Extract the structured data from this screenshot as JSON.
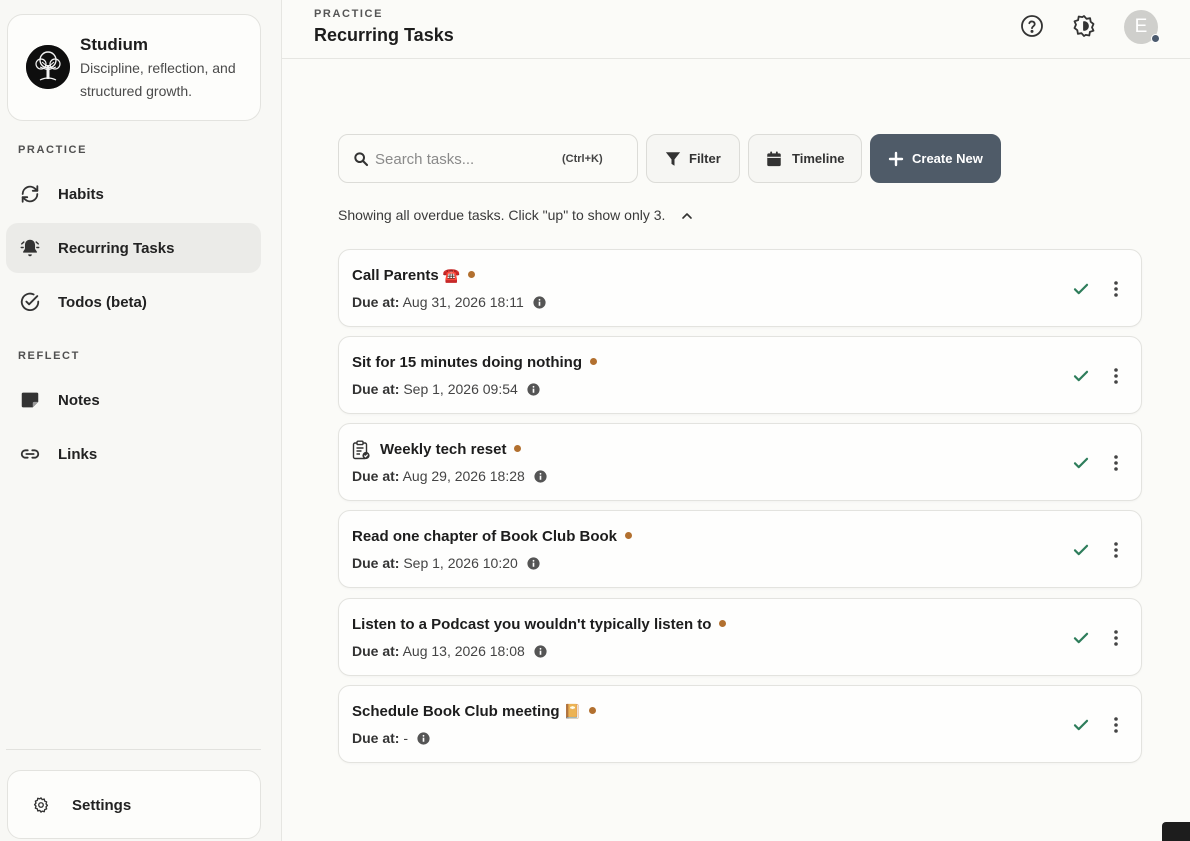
{
  "sidebar": {
    "brand": {
      "name": "Studium",
      "tagline": "Discipline, reflection, and structured growth."
    },
    "sections": [
      {
        "label": "PRACTICE"
      },
      {
        "label": "REFLECT"
      }
    ],
    "items": [
      {
        "label": "Habits",
        "icon": "refresh-icon"
      },
      {
        "label": "Recurring Tasks",
        "icon": "bell-icon",
        "active": true
      },
      {
        "label": "Todos (beta)",
        "icon": "check-circle-icon"
      },
      {
        "label": "Notes",
        "icon": "note-icon"
      },
      {
        "label": "Links",
        "icon": "link-icon"
      }
    ],
    "settings": {
      "label": "Settings",
      "icon": "gear-icon"
    }
  },
  "header": {
    "eyebrow": "PRACTICE",
    "title": "Recurring Tasks",
    "avatar_initial": "E"
  },
  "toolbar": {
    "search_placeholder": "Search tasks...",
    "search_shortcut": "(Ctrl+K)",
    "filter_label": "Filter",
    "timeline_label": "Timeline",
    "create_label": "Create New"
  },
  "notice": "Showing all overdue tasks. Click \"up\" to show only 3.",
  "tasks": [
    {
      "title": "Call Parents",
      "emoji": "☎️",
      "due_label": "Due at:",
      "due": "Aug 31, 2026 18:11"
    },
    {
      "title": "Sit for 15 minutes doing nothing",
      "emoji": "",
      "due_label": "Due at:",
      "due": "Sep 1, 2026 09:54"
    },
    {
      "title": "Weekly tech reset",
      "emoji": "",
      "due_label": "Due at:",
      "due": "Aug 29, 2026 18:28"
    },
    {
      "title": "Read one chapter of Book Club Book",
      "emoji": "",
      "due_label": "Due at:",
      "due": "Sep 1, 2026 10:20"
    },
    {
      "title": "Listen to a Podcast you wouldn't typically listen to",
      "emoji": "",
      "due_label": "Due at:",
      "due": "Aug 13, 2026 18:08"
    },
    {
      "title": "Schedule Book Club meeting",
      "emoji": "📔",
      "due_label": "Due at:",
      "due": "-"
    }
  ],
  "colors": {
    "accent": "#4f5b68",
    "status_dot": "#b2702f",
    "check": "#2e7d5b",
    "active_nav": "#ebebe8"
  }
}
